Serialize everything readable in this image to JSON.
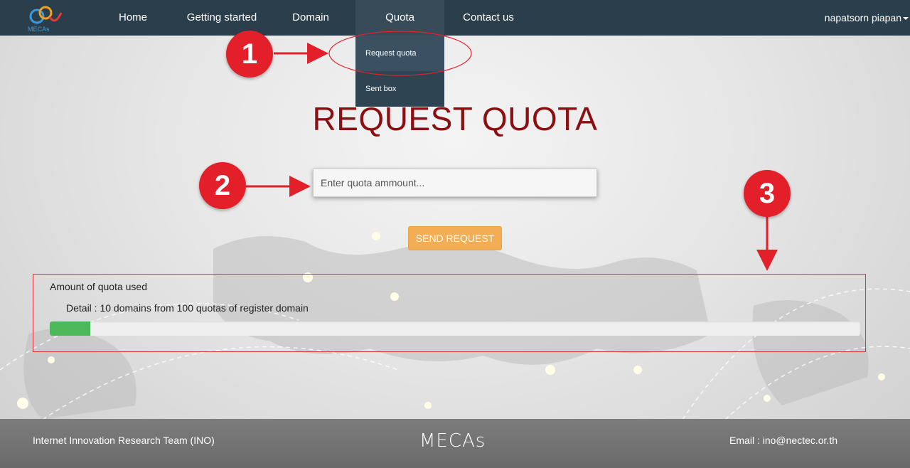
{
  "navbar": {
    "logo_text": "MECAs",
    "items": [
      {
        "label": "Home"
      },
      {
        "label": "Getting started"
      },
      {
        "label": "Domain"
      },
      {
        "label": "Quota"
      },
      {
        "label": "Contact us"
      }
    ],
    "user_name": "napatsorn piapan"
  },
  "quota_menu": {
    "items": [
      {
        "label": "Request quota"
      },
      {
        "label": "Sent box"
      }
    ]
  },
  "main": {
    "title": "REQUEST QUOTA",
    "input_placeholder": "Enter quota ammount...",
    "send_button": "SEND REQUEST"
  },
  "quota_panel": {
    "heading": "Amount of quota used",
    "detail": "Detail : 10 domains from 100 quotas of register domain",
    "used": 10,
    "total": 100,
    "progress_fraction": 0.05
  },
  "annotations": [
    {
      "number": "1"
    },
    {
      "number": "2"
    },
    {
      "number": "3"
    }
  ],
  "footer": {
    "team": "Internet Innovation Research Team (INO)",
    "logo": "MECAs",
    "email": "Email : ino@nectec.or.th"
  },
  "colors": {
    "navbar_bg": "#2b3e4b",
    "title_red": "#8b0f12",
    "send_button_orange": "#f2ad55",
    "progress_green": "#4cb85a",
    "annotation_red": "#e3202a"
  }
}
